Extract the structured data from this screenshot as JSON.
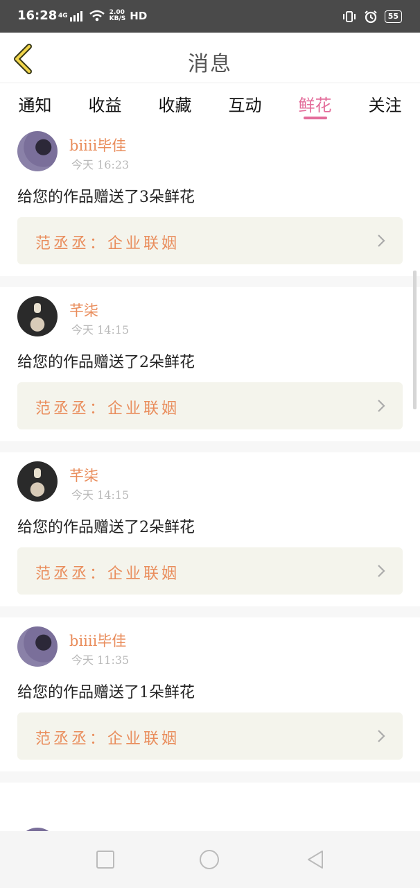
{
  "status_bar": {
    "time": "16:28",
    "network": "4G",
    "speed": "2.00",
    "speed_unit": "KB/S",
    "hd": "HD",
    "battery": "55"
  },
  "header": {
    "title": "消息"
  },
  "tabs": [
    {
      "label": "通知",
      "active": false
    },
    {
      "label": "收益",
      "active": false
    },
    {
      "label": "收藏",
      "active": false
    },
    {
      "label": "互动",
      "active": false
    },
    {
      "label": "鲜花",
      "active": true
    },
    {
      "label": "关注",
      "active": false
    }
  ],
  "messages": [
    {
      "name": "biiii毕佳",
      "time": "今天 16:23",
      "text": "给您的作品赠送了3朵鲜花",
      "work": "范丞丞：企业联姻"
    },
    {
      "name": "芊柒",
      "time": "今天 14:15",
      "text": "给您的作品赠送了2朵鲜花",
      "work": "范丞丞：企业联姻"
    },
    {
      "name": "芊柒",
      "time": "今天 14:15",
      "text": "给您的作品赠送了2朵鲜花",
      "work": "范丞丞：企业联姻"
    },
    {
      "name": "biiii毕佳",
      "time": "今天 11:35",
      "text": "给您的作品赠送了1朵鲜花",
      "work": "范丞丞：企业联姻"
    }
  ],
  "colors": {
    "accent": "#e36c9a",
    "name": "#e98d5c",
    "card_bg": "#f4f4ec"
  }
}
